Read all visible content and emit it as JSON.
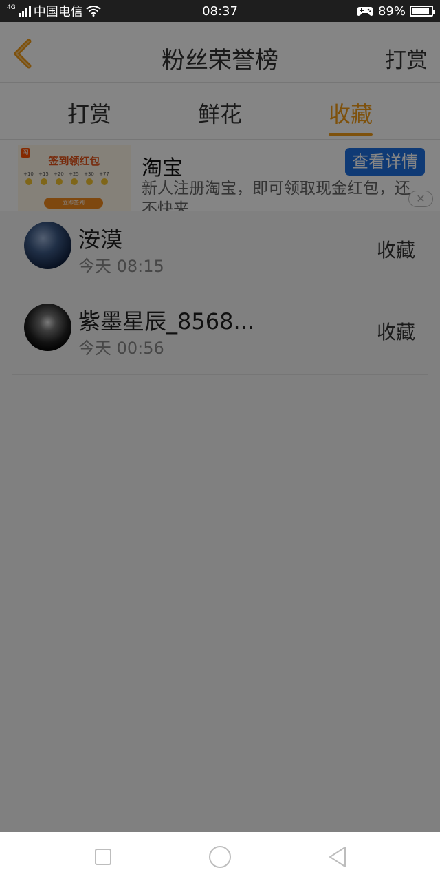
{
  "status_bar": {
    "network": "4G",
    "carrier": "中国电信",
    "time": "08:37",
    "battery": "89%",
    "battery_level": 0.89
  },
  "header": {
    "back_icon": "chevron-left-icon",
    "title": "粉丝荣誉榜",
    "right_action": "打赏"
  },
  "tabs": [
    {
      "label": "打赏",
      "active": false
    },
    {
      "label": "鲜花",
      "active": false
    },
    {
      "label": "收藏",
      "active": true
    }
  ],
  "ad": {
    "image_headline": "签到领红包",
    "image_days": [
      "+10",
      "+15",
      "+20",
      "+25",
      "+30",
      "+77"
    ],
    "image_cta": "立即签到",
    "title": "淘宝",
    "description": "新人注册淘宝，即可领取现金红包，还不快来",
    "button": "查看详情",
    "close_icon": "close-icon"
  },
  "list": [
    {
      "name": "洝漠",
      "time": "今天 08:15",
      "action": "收藏"
    },
    {
      "name": "紫墨星辰_8568...",
      "time": "今天 00:56",
      "action": "收藏"
    }
  ],
  "nav": [
    "square-icon",
    "circle-icon",
    "triangle-back-icon"
  ],
  "colors": {
    "accent": "#f29b17",
    "ad_button": "#1e6fe0",
    "overlay": "rgba(0,0,0,0.48)"
  }
}
